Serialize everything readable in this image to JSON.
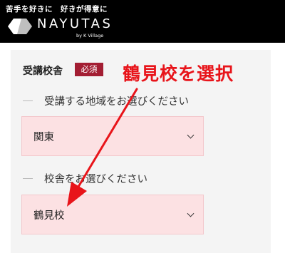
{
  "header": {
    "tagline": "苦手を好きに　好きが得意に",
    "logo_text": "NAYUTAS",
    "logo_sub": "by K Village"
  },
  "form": {
    "section_title": "受講校舎",
    "required_badge": "必須",
    "region": {
      "label": "受講する地域をお選びください",
      "selected_value": "関東"
    },
    "school": {
      "label": "校舎をお選びください",
      "selected_value": "鶴見校"
    }
  },
  "annotation": {
    "text": "鶴見校を選択",
    "color": "#e8141a"
  },
  "colors": {
    "header_bg": "#000000",
    "badge_bg": "#a31e33",
    "select_bg": "#fce1e3",
    "panel_bg": "#f4f4f4"
  }
}
